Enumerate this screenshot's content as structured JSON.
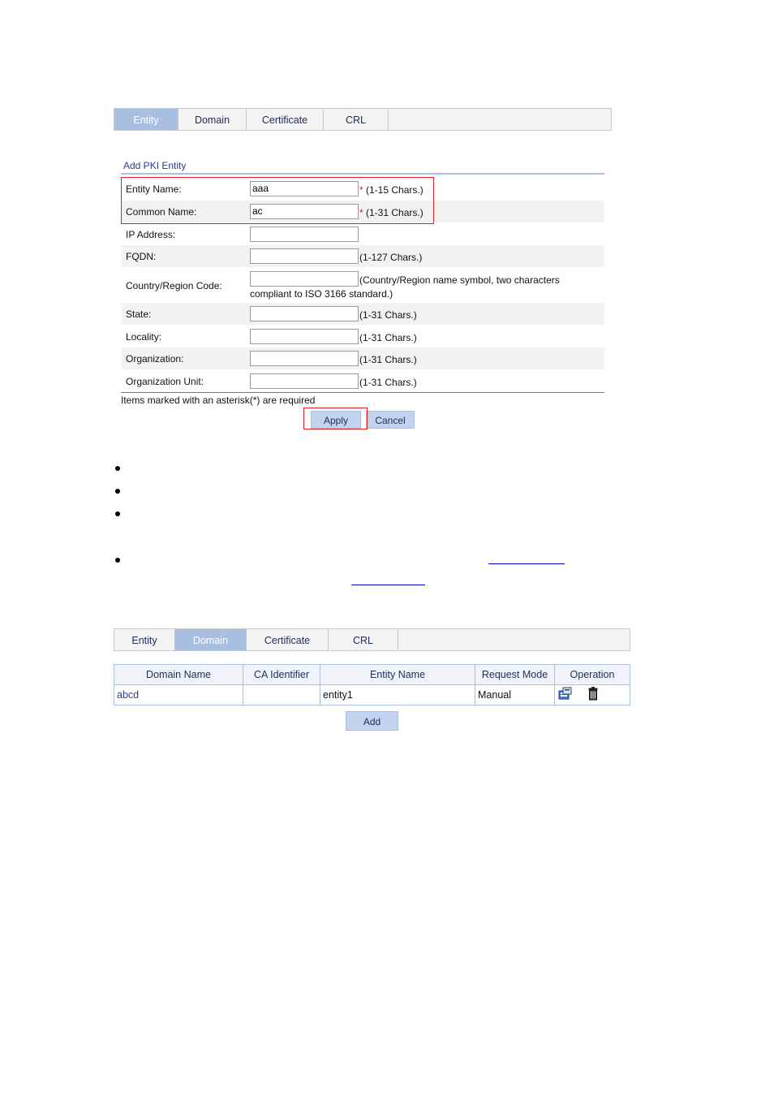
{
  "top_tabs": [
    "Entity",
    "Domain",
    "Certificate",
    "CRL"
  ],
  "form": {
    "title": "Add PKI Entity",
    "fields": [
      {
        "label": "Entity Name:",
        "value": "aaa",
        "req": "*",
        "hint": " (1-15 Chars.)"
      },
      {
        "label": "Common Name:",
        "value": "ac",
        "req": "*",
        "hint": " (1-31 Chars.)"
      },
      {
        "label": "IP Address:",
        "value": "",
        "req": "",
        "hint": ""
      },
      {
        "label": "FQDN:",
        "value": "",
        "req": "",
        "hint": "(1-127 Chars.)"
      },
      {
        "label": "Country/Region Code:",
        "value": "",
        "req": "",
        "hint": "(Country/Region name symbol, two characters",
        "hint2": "compliant to ISO 3166 standard.)"
      },
      {
        "label": "State:",
        "value": "",
        "req": "",
        "hint": "(1-31 Chars.)"
      },
      {
        "label": "Locality:",
        "value": "",
        "req": "",
        "hint": "(1-31 Chars.)"
      },
      {
        "label": "Organization:",
        "value": "",
        "req": "",
        "hint": "(1-31 Chars.)"
      },
      {
        "label": "Organization Unit:",
        "value": "",
        "req": "",
        "hint": "(1-31 Chars.)"
      }
    ],
    "required_note": "Items marked with an asterisk(*) are required",
    "apply_label": "Apply",
    "cancel_label": "Cancel"
  },
  "bottom_tabs": [
    "Entity",
    "Domain",
    "Certificate",
    "CRL"
  ],
  "domain_table": {
    "headers": [
      "Domain Name",
      "CA Identifier",
      "Entity Name",
      "Request Mode",
      "Operation"
    ],
    "rows": [
      {
        "domain_name": "abcd",
        "ca_identifier": "",
        "entity_name": "entity1",
        "request_mode": "Manual"
      }
    ],
    "operation_icons": [
      "request-certificate-icon",
      "delete-trash-icon"
    ]
  },
  "add_label": "Add",
  "colors": {
    "active_tab": "#a9bfe2",
    "highlight": "#e02020",
    "link": "#2a3a9a"
  }
}
